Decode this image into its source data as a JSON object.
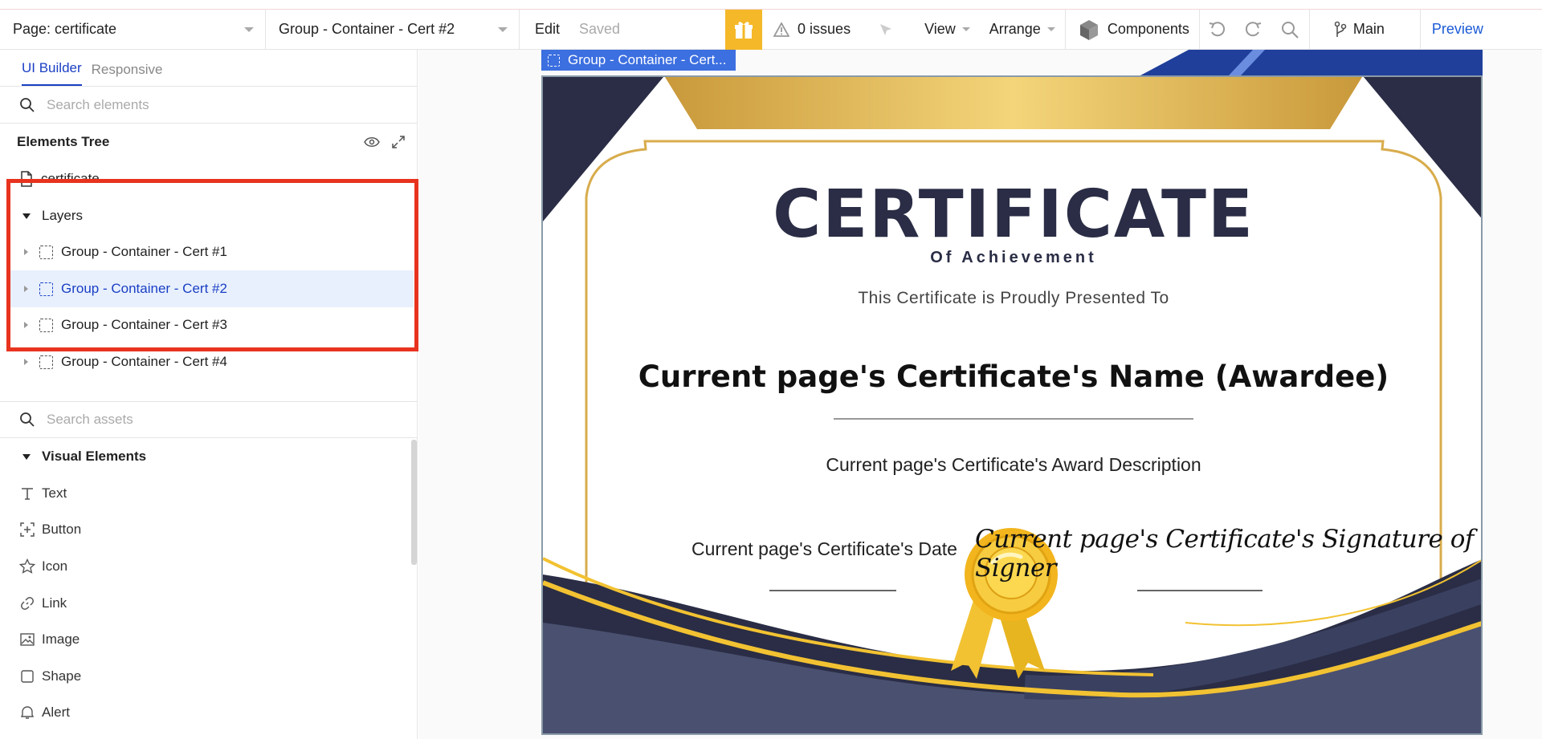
{
  "topbar": {
    "page_dropdown": "Page: certificate",
    "element_dropdown": "Group - Container - Cert #2",
    "edit": "Edit",
    "saved": "Saved",
    "issues": "0 issues",
    "view": "View",
    "arrange": "Arrange",
    "components": "Components",
    "branch": "Main",
    "preview": "Preview"
  },
  "left_panel": {
    "tabs": [
      "UI Builder",
      "Responsive"
    ],
    "search_elements_placeholder": "Search elements",
    "tree_title": "Elements Tree",
    "page_item": "certificate",
    "layers_label": "Layers",
    "layers": [
      {
        "label": "Group - Container - Cert #1",
        "selected": false
      },
      {
        "label": "Group - Container - Cert #2",
        "selected": true
      },
      {
        "label": "Group - Container - Cert #3",
        "selected": false
      },
      {
        "label": "Group - Container - Cert #4",
        "selected": false
      }
    ],
    "search_assets_placeholder": "Search assets",
    "visual_elements_title": "Visual Elements",
    "visual_elements": [
      {
        "label": "Text",
        "icon": "text-icon"
      },
      {
        "label": "Button",
        "icon": "button-icon"
      },
      {
        "label": "Icon",
        "icon": "star-icon"
      },
      {
        "label": "Link",
        "icon": "link-icon"
      },
      {
        "label": "Image",
        "icon": "image-icon"
      },
      {
        "label": "Shape",
        "icon": "shape-icon"
      },
      {
        "label": "Alert",
        "icon": "alert-icon"
      }
    ]
  },
  "canvas": {
    "selection_tag": "Group - Container - Cert...",
    "certificate": {
      "title": "CERTIFICATE",
      "subtitle": "Of Achievement",
      "presented": "This Certificate is Proudly Presented To",
      "name": "Current page's Certificate's Name (Awardee)",
      "description": "Current page's Certificate's Award Description",
      "date": "Current page's Certificate's Date",
      "signature": "Current page's Certificate's Signature of Signer"
    }
  },
  "colors": {
    "accent": "#1a3fc4",
    "highlight_box": "#e8331f",
    "gift": "#f5b829",
    "navy": "#2a2d45",
    "gold": "#e0b44a"
  }
}
